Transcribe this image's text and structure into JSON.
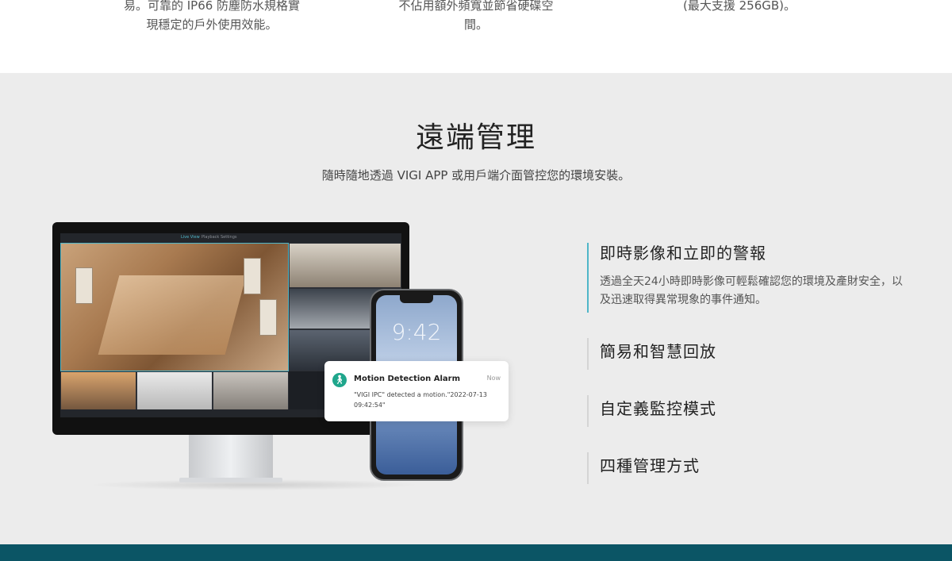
{
  "top": {
    "col1": {
      "line1": "易。可靠的 IP66 防塵防水規格實",
      "line2": "現穩定的戶外使用效能。"
    },
    "col2": {
      "line1": "不佔用額外頻寬並節省硬碟空",
      "line2": "間。"
    },
    "col3": {
      "line1": "(最大支援 256GB)。",
      "line2": ""
    }
  },
  "section": {
    "title": "遠端管理",
    "subtitle": "隨時隨地透過 VIGI APP 或用戶端介面管控您的環境安裝。"
  },
  "monitor": {
    "tabs": [
      "Live View",
      "Playback",
      "Settings"
    ]
  },
  "phone": {
    "time": "9:42"
  },
  "notification": {
    "title": "Motion Detection Alarm",
    "time": "Now",
    "body": "\"VIGI IPC\" detected a motion.\"2022-07-13 09:42:54\""
  },
  "features": [
    {
      "title": "即時影像和立即的警報",
      "desc": "透過全天24小時即時影像可輕鬆確認您的環境及產財安全，以及迅速取得異常現象的事件通知。"
    },
    {
      "title": "簡易和智慧回放"
    },
    {
      "title": "自定義監控模式"
    },
    {
      "title": "四種管理方式"
    }
  ],
  "colors": {
    "accent": "#4fb6c8",
    "band": "#0b5565",
    "section_bg": "#ececec",
    "alarm_icon": "#1fa68c"
  }
}
